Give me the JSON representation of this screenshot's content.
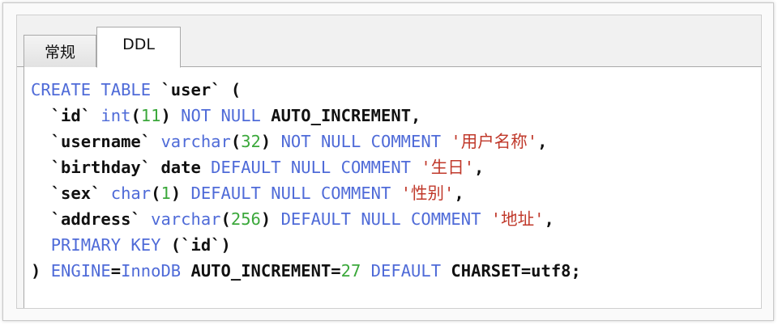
{
  "tabs": [
    {
      "label": "常规"
    },
    {
      "label": "DDL"
    }
  ],
  "colors": {
    "keyword": "#4f6bd8",
    "number": "#3ba83b",
    "string": "#c0392b",
    "plain": "#111111"
  },
  "ddl_lines": [
    [
      {
        "t": "CREATE TABLE",
        "c": "kw"
      },
      {
        "t": " `user` (",
        "c": "plain"
      }
    ],
    [
      {
        "t": "  `id` ",
        "c": "plain"
      },
      {
        "t": "int",
        "c": "kw"
      },
      {
        "t": "(",
        "c": "plain"
      },
      {
        "t": "11",
        "c": "num"
      },
      {
        "t": ") ",
        "c": "plain"
      },
      {
        "t": "NOT NULL",
        "c": "kw"
      },
      {
        "t": " AUTO_INCREMENT,",
        "c": "plain"
      }
    ],
    [
      {
        "t": "  `username` ",
        "c": "plain"
      },
      {
        "t": "varchar",
        "c": "kw"
      },
      {
        "t": "(",
        "c": "plain"
      },
      {
        "t": "32",
        "c": "num"
      },
      {
        "t": ") ",
        "c": "plain"
      },
      {
        "t": "NOT NULL COMMENT",
        "c": "kw"
      },
      {
        "t": " ",
        "c": "plain"
      },
      {
        "t": "'用户名称'",
        "c": "str"
      },
      {
        "t": ",",
        "c": "plain"
      }
    ],
    [
      {
        "t": "  `birthday` date ",
        "c": "plain"
      },
      {
        "t": "DEFAULT NULL COMMENT",
        "c": "kw"
      },
      {
        "t": " ",
        "c": "plain"
      },
      {
        "t": "'生日'",
        "c": "str"
      },
      {
        "t": ",",
        "c": "plain"
      }
    ],
    [
      {
        "t": "  `sex` ",
        "c": "plain"
      },
      {
        "t": "char",
        "c": "kw"
      },
      {
        "t": "(",
        "c": "plain"
      },
      {
        "t": "1",
        "c": "num"
      },
      {
        "t": ") ",
        "c": "plain"
      },
      {
        "t": "DEFAULT NULL COMMENT",
        "c": "kw"
      },
      {
        "t": " ",
        "c": "plain"
      },
      {
        "t": "'性别'",
        "c": "str"
      },
      {
        "t": ",",
        "c": "plain"
      }
    ],
    [
      {
        "t": "  `address` ",
        "c": "plain"
      },
      {
        "t": "varchar",
        "c": "kw"
      },
      {
        "t": "(",
        "c": "plain"
      },
      {
        "t": "256",
        "c": "num"
      },
      {
        "t": ") ",
        "c": "plain"
      },
      {
        "t": "DEFAULT NULL COMMENT",
        "c": "kw"
      },
      {
        "t": " ",
        "c": "plain"
      },
      {
        "t": "'地址'",
        "c": "str"
      },
      {
        "t": ",",
        "c": "plain"
      }
    ],
    [
      {
        "t": "  ",
        "c": "plain"
      },
      {
        "t": "PRIMARY KEY",
        "c": "kw"
      },
      {
        "t": " (`id`)",
        "c": "plain"
      }
    ],
    [
      {
        "t": ") ",
        "c": "plain"
      },
      {
        "t": "ENGINE",
        "c": "kw"
      },
      {
        "t": "=",
        "c": "plain"
      },
      {
        "t": "InnoDB",
        "c": "kw"
      },
      {
        "t": " AUTO_INCREMENT=",
        "c": "plain"
      },
      {
        "t": "27",
        "c": "num"
      },
      {
        "t": " ",
        "c": "plain"
      },
      {
        "t": "DEFAULT",
        "c": "kw"
      },
      {
        "t": " CHARSET=utf8;",
        "c": "plain"
      }
    ]
  ]
}
